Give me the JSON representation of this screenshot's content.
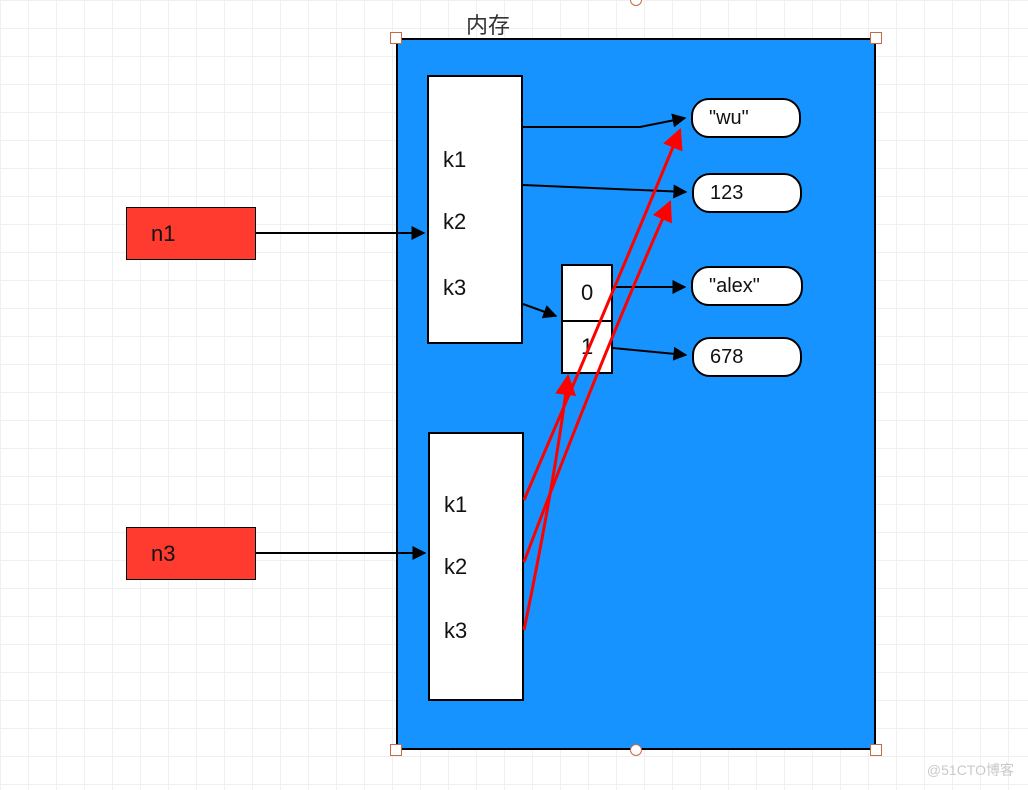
{
  "title": "内存",
  "vars": {
    "n1": "n1",
    "n3": "n3"
  },
  "dict1": {
    "k1": "k1",
    "k2": "k2",
    "k3": "k3"
  },
  "dict2": {
    "k1": "k1",
    "k2": "k2",
    "k3": "k3"
  },
  "list": {
    "i0": "0",
    "i1": "1"
  },
  "values": {
    "wu": "\"wu\"",
    "v123": "123",
    "alex": "\"alex\"",
    "v678": "678"
  },
  "watermark": "@51CTO博客"
}
